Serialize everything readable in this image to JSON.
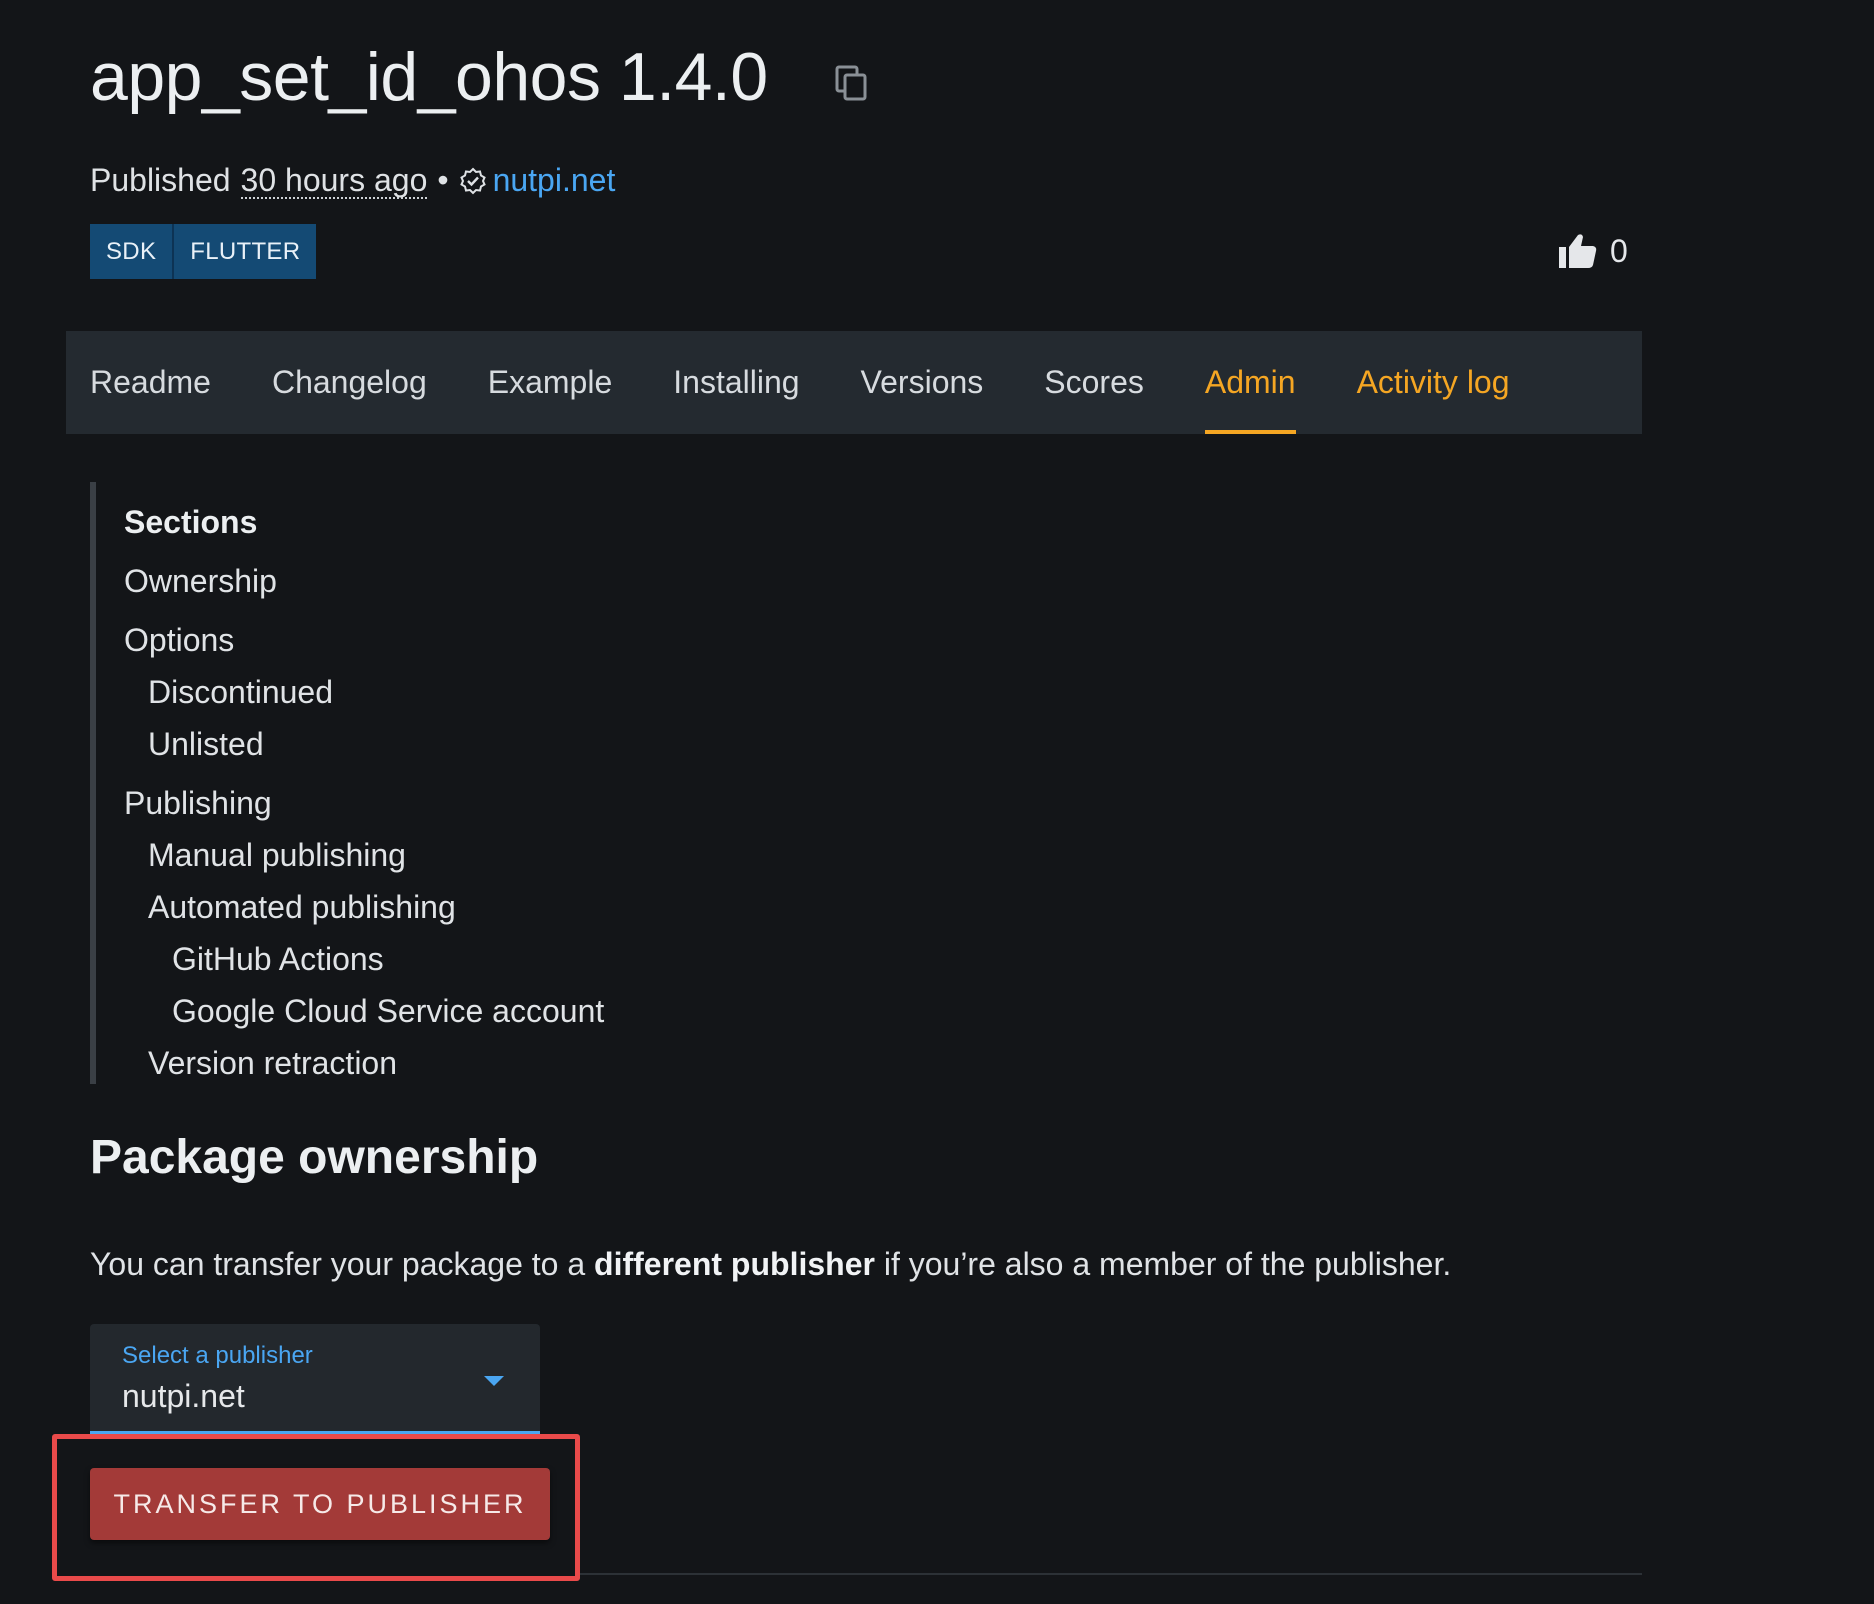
{
  "package": {
    "title": "app_set_id_ohos 1.4.0",
    "published_prefix": "Published",
    "published_ago": "30 hours ago",
    "separator": "•",
    "publisher": "nutpi.net",
    "tags": [
      "SDK",
      "FLUTTER"
    ],
    "likes": "0"
  },
  "tabs": [
    {
      "label": "Readme"
    },
    {
      "label": "Changelog"
    },
    {
      "label": "Example"
    },
    {
      "label": "Installing"
    },
    {
      "label": "Versions"
    },
    {
      "label": "Scores"
    },
    {
      "label": "Admin"
    },
    {
      "label": "Activity log"
    }
  ],
  "toc": {
    "heading": "Sections",
    "items": [
      {
        "label": "Ownership"
      },
      {
        "label": "Options"
      },
      {
        "label": "Discontinued"
      },
      {
        "label": "Unlisted"
      },
      {
        "label": "Publishing"
      },
      {
        "label": "Manual publishing"
      },
      {
        "label": "Automated publishing"
      },
      {
        "label": "GitHub Actions"
      },
      {
        "label": "Google Cloud Service account"
      },
      {
        "label": "Version retraction"
      }
    ]
  },
  "ownership": {
    "title": "Package ownership",
    "desc_before": "You can transfer your package to a ",
    "desc_bold": "different publisher",
    "desc_after": " if you’re also a member of the publisher.",
    "select_label": "Select a publisher",
    "select_value": "nutpi.net",
    "transfer_button": "TRANSFER TO PUBLISHER"
  },
  "colors": {
    "background": "#131518",
    "accent": "#f5a623",
    "link": "#4aa6f2",
    "danger_button": "#a33a38",
    "highlight": "#e94a4a"
  },
  "icons": [
    "copy-icon",
    "verified-publisher-icon",
    "thumbs-up-icon",
    "caret-down-icon"
  ]
}
